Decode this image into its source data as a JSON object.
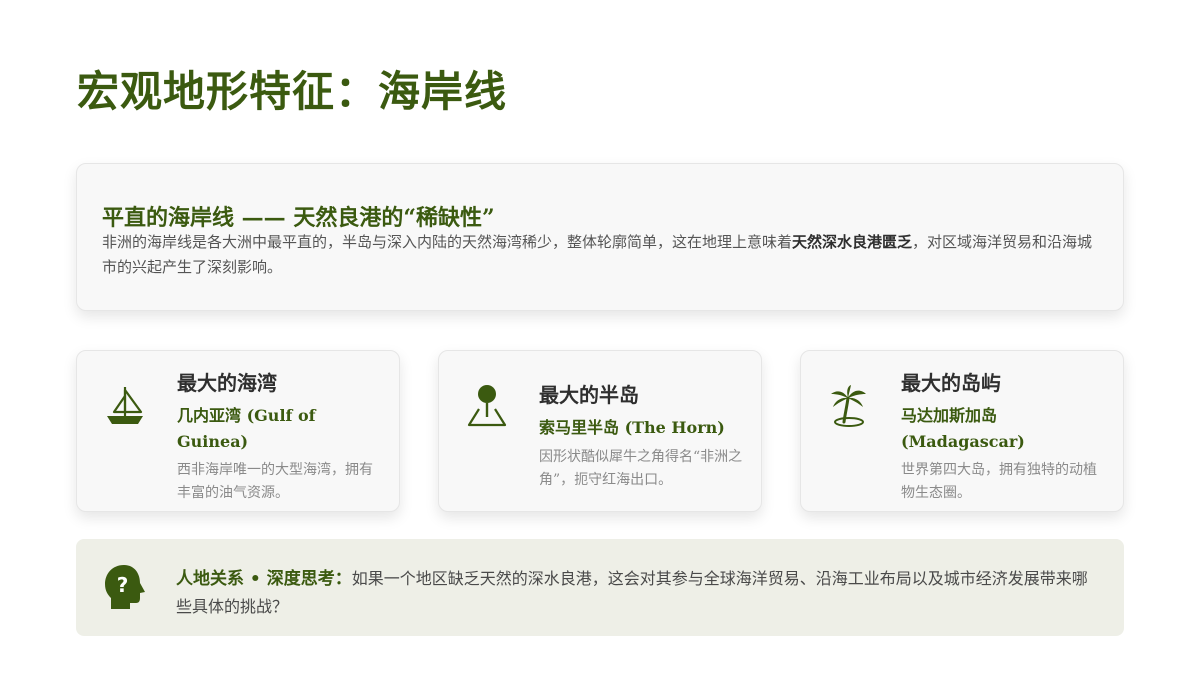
{
  "title": "宏观地形特征：海岸线",
  "intro": {
    "heading": "平直的海岸线 —— 天然良港的“稀缺性”",
    "text_before": "非洲的海岸线是各大洲中最平直的，半岛与深入内陆的天然海湾稀少，整体轮廓简单，这在地理上意味着",
    "text_bold": "天然深水良港匮乏",
    "text_after": "，对区域海洋贸易和沿海城市的兴起产生了深刻影响。"
  },
  "cards": [
    {
      "icon": "sailboat-icon",
      "title": "最大的海湾",
      "name": "几内亚湾 (Gulf of Guinea)",
      "desc": "西非海岸唯一的大型海湾，拥有丰富的油气资源。"
    },
    {
      "icon": "location-pin-icon",
      "title": "最大的半岛",
      "name": "索马里半岛 (The Horn)",
      "desc": "因形状酷似犀牛之角得名“非洲之角”，扼守红海出口。"
    },
    {
      "icon": "palm-island-icon",
      "title": "最大的岛屿",
      "name": "马达加斯加岛 (Madagascar)",
      "desc": "世界第四大岛，拥有独特的动植物生态圈。"
    }
  ],
  "thinking": {
    "icon": "head-question-icon",
    "label": "人地关系 • 深度思考：",
    "text": "如果一个地区缺乏天然的深水良港，这会对其参与全球海洋贸易、沿海工业布局以及城市经济发展带来哪些具体的挑战？"
  },
  "colors": {
    "accent": "#3b5a10",
    "panel_bg": "#f8f8f8",
    "think_bg": "#eeefe7",
    "muted_text": "#8a8a8a"
  }
}
